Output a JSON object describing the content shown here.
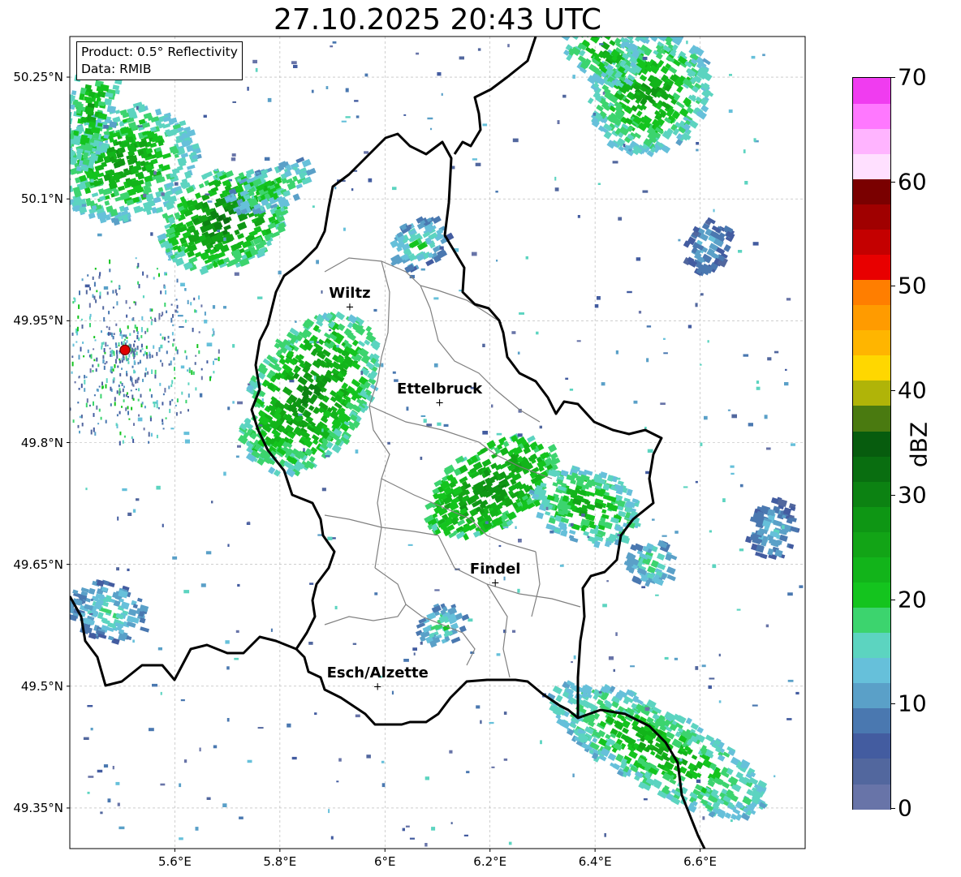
{
  "title": "27.10.2025 20:43 UTC",
  "info": {
    "product": "Product: 0.5° Reflectivity",
    "data": "Data: RMIB"
  },
  "map": {
    "lon_range": [
      5.4,
      6.8
    ],
    "lat_range": [
      49.3,
      50.3
    ],
    "lat_ticks": [
      {
        "value": 50.25,
        "label": "50.25°N"
      },
      {
        "value": 50.1,
        "label": "50.1°N"
      },
      {
        "value": 49.95,
        "label": "49.95°N"
      },
      {
        "value": 49.8,
        "label": "49.8°N"
      },
      {
        "value": 49.65,
        "label": "49.65°N"
      },
      {
        "value": 49.5,
        "label": "49.5°N"
      },
      {
        "value": 49.35,
        "label": "49.35°N"
      }
    ],
    "lon_ticks": [
      {
        "value": 5.6,
        "label": "5.6°E"
      },
      {
        "value": 5.8,
        "label": "5.8°E"
      },
      {
        "value": 6.0,
        "label": "6°E"
      },
      {
        "value": 6.2,
        "label": "6.2°E"
      },
      {
        "value": 6.4,
        "label": "6.4°E"
      },
      {
        "value": 6.6,
        "label": "6.6°E"
      }
    ],
    "grid": true,
    "radar_site": {
      "lon": 5.505,
      "lat": 49.914
    },
    "cities": [
      {
        "name": "Wiltz",
        "lon": 5.933,
        "lat": 49.966
      },
      {
        "name": "Ettelbruck",
        "lon": 6.104,
        "lat": 49.848
      },
      {
        "name": "Findel",
        "lon": 6.21,
        "lat": 49.627
      },
      {
        "name": "Esch/Alzette",
        "lon": 5.986,
        "lat": 49.499
      }
    ]
  },
  "colorbar": {
    "label": "dBZ",
    "min": 0,
    "max": 70,
    "ticks": [
      "0",
      "10",
      "20",
      "30",
      "40",
      "50",
      "60",
      "70"
    ],
    "colors": [
      "#6874a8",
      "#52679e",
      "#435ca0",
      "#4a78b0",
      "#5aa0c8",
      "#66c0da",
      "#5cd4c0",
      "#3cd46e",
      "#14c41e",
      "#12b41a",
      "#12a416",
      "#0e9614",
      "#0c8212",
      "#096e10",
      "#075c0e",
      "#4a7a10",
      "#b0b408",
      "#ffd700",
      "#ffb500",
      "#ff9b00",
      "#ff7e00",
      "#e80000",
      "#c40000",
      "#a00000",
      "#7a0000",
      "#ffe0ff",
      "#ffb4ff",
      "#ff78ff",
      "#f03cf0"
    ]
  },
  "colors": {
    "border": "#000000",
    "cantons": "#808080",
    "radar_site": "#e00000"
  }
}
